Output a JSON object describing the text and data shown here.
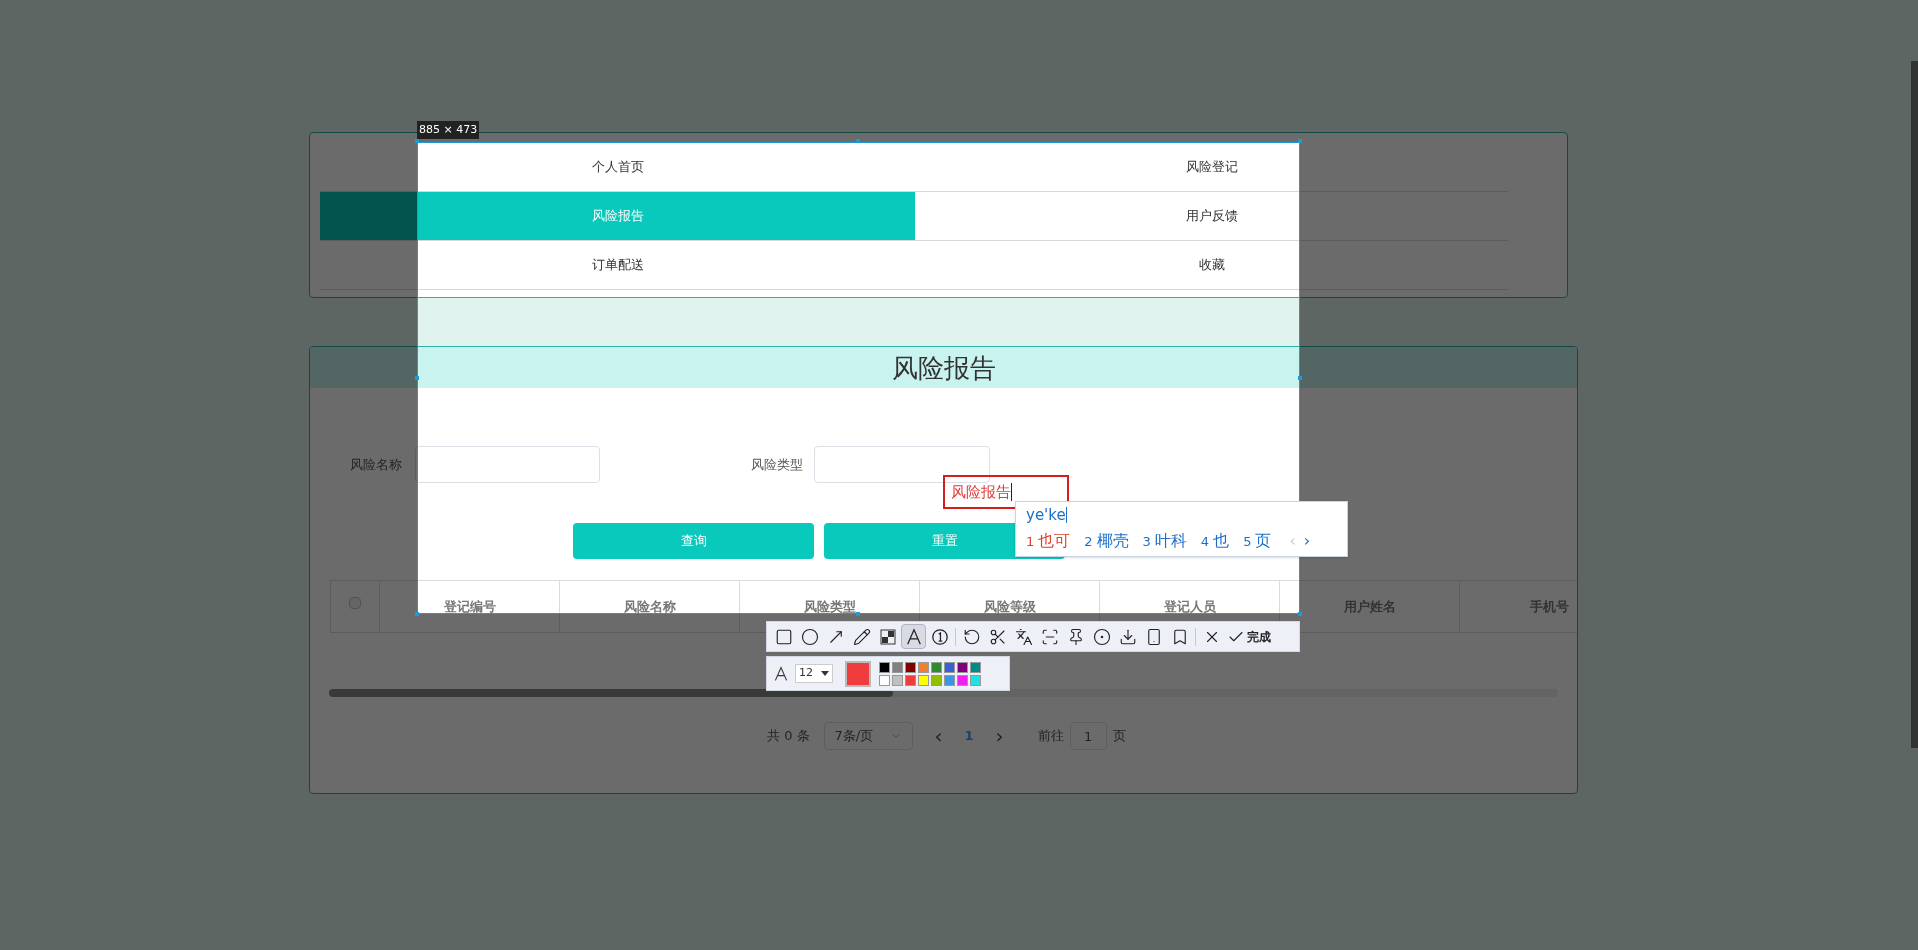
{
  "menu": [
    {
      "label": "个人首页",
      "selected": false
    },
    {
      "label": "风险登记",
      "selected": false
    },
    {
      "label": "风险报告",
      "selected": true
    },
    {
      "label": "用户反馈",
      "selected": false
    },
    {
      "label": "订单配送",
      "selected": false
    },
    {
      "label": "收藏",
      "selected": false
    }
  ],
  "page_title": "风险报告",
  "form": {
    "fields": [
      {
        "label": "风险名称"
      },
      {
        "label": "风险类型"
      }
    ],
    "buttons": [
      "查询",
      "重置"
    ]
  },
  "table": {
    "columns": [
      "登记编号",
      "风险名称",
      "风险类型",
      "风险等级",
      "登记人员",
      "用户姓名",
      "手机号"
    ],
    "select_all_checked": false
  },
  "pagination": {
    "total": "共 0 条",
    "page_size": "7条/页",
    "prev": "‹",
    "pages": [
      {
        "label": "1",
        "selected": true
      }
    ],
    "next": "›",
    "goto_label": "前往",
    "goto_value": "1",
    "goto_suffix": "页"
  },
  "capture": {
    "size_label": "885 × 473",
    "annotation": "风险报告",
    "ime": {
      "input": "ye'ke",
      "candidates": [
        {
          "number": "1",
          "text": "也可",
          "selected": true
        },
        {
          "number": "2",
          "text": "椰壳",
          "selected": false
        },
        {
          "number": "3",
          "text": "叶科",
          "selected": false
        },
        {
          "number": "4",
          "text": "也",
          "selected": false
        },
        {
          "number": "5",
          "text": "页",
          "selected": false
        }
      ],
      "prev": "‹",
      "next": "›"
    },
    "tools": [
      {
        "kind": "rectangle",
        "selected": false
      },
      {
        "kind": "ellipse",
        "selected": false
      },
      {
        "kind": "arrow",
        "selected": false
      },
      {
        "kind": "pencil",
        "selected": false
      },
      {
        "kind": "mosaic",
        "selected": false
      },
      {
        "kind": "text",
        "selected": true
      },
      {
        "kind": "number",
        "selected": false
      },
      {
        "kind": "divider"
      },
      {
        "kind": "undo",
        "selected": false
      },
      {
        "kind": "cut",
        "selected": false
      },
      {
        "kind": "translate",
        "selected": false
      },
      {
        "kind": "scan",
        "selected": false
      },
      {
        "kind": "pin",
        "selected": false
      },
      {
        "kind": "record",
        "selected": false
      },
      {
        "kind": "download",
        "selected": false
      },
      {
        "kind": "phone",
        "selected": false
      },
      {
        "kind": "bookmark",
        "selected": false
      },
      {
        "kind": "divider"
      },
      {
        "kind": "close",
        "selected": false
      }
    ],
    "done_label": "完成",
    "font_size": "12",
    "palette": [
      {
        "color": "#000000"
      },
      {
        "color": "#808080"
      },
      {
        "color": "#800000"
      },
      {
        "color": "#f08030"
      },
      {
        "color": "#2e8b30"
      },
      {
        "color": "#3a5fd8"
      },
      {
        "color": "#800080"
      },
      {
        "color": "#008b8b"
      },
      {
        "color": "#ffffff"
      },
      {
        "color": "#c0c0c0"
      },
      {
        "color": "#f03c3c",
        "selected": true
      },
      {
        "color": "#ffff00"
      },
      {
        "color": "#90c000"
      },
      {
        "color": "#3c96e6"
      },
      {
        "color": "#f020f0"
      },
      {
        "color": "#20e0e0"
      }
    ]
  }
}
